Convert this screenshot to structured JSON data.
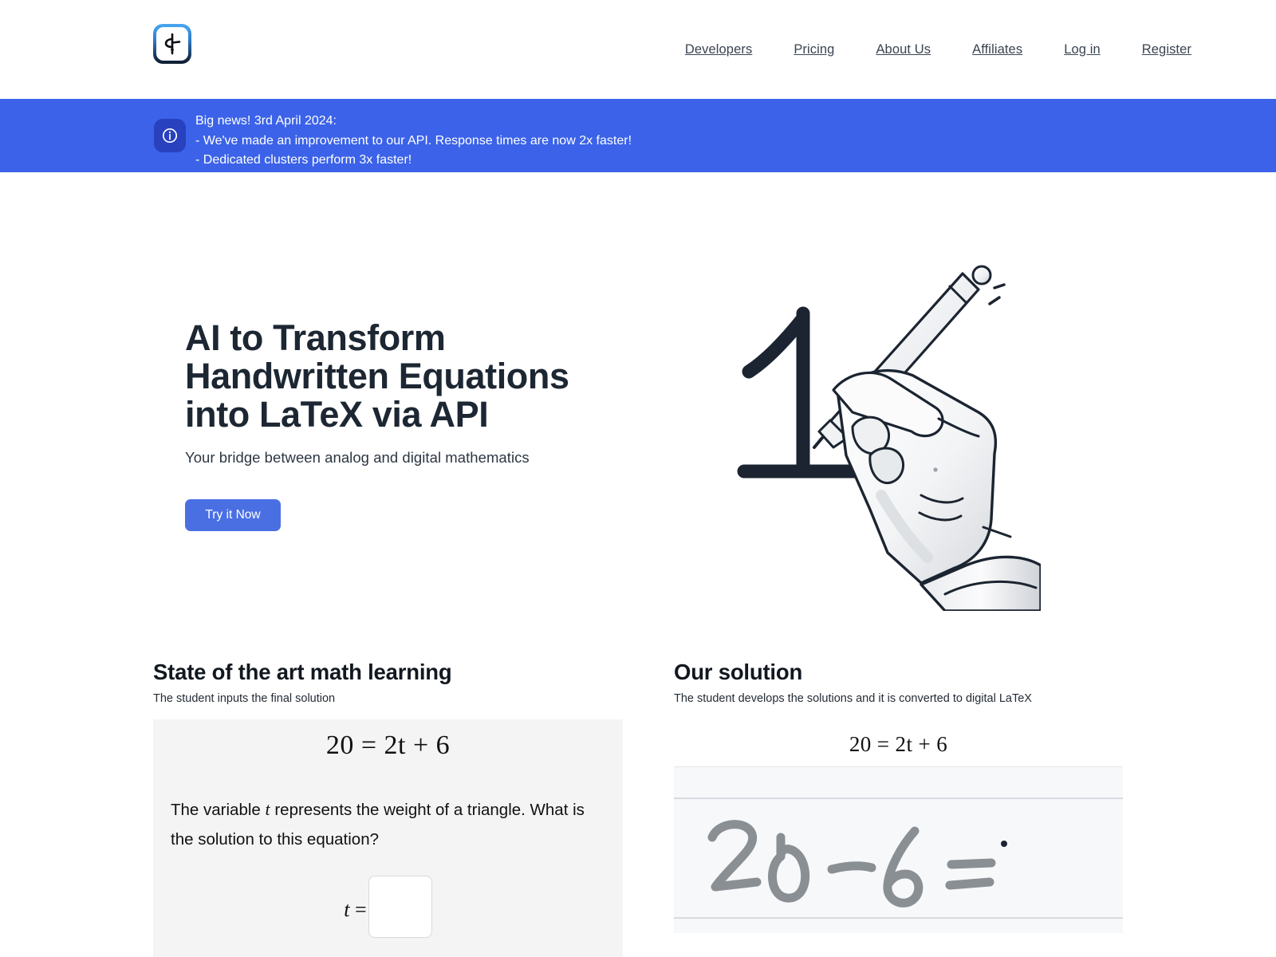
{
  "header": {
    "logo_icon": "pen-nib-logo-icon",
    "nav": [
      {
        "label": "Developers",
        "name": "developers"
      },
      {
        "label": "Pricing",
        "name": "pricing"
      },
      {
        "label": "About Us",
        "name": "about-us"
      },
      {
        "label": "Affiliates",
        "name": "affiliates"
      },
      {
        "label": "Log in",
        "name": "log-in"
      },
      {
        "label": "Register",
        "name": "register"
      }
    ]
  },
  "banner": {
    "icon": "info-circle-icon",
    "background_color": "#3b62e8",
    "icon_background_color": "#2741bf",
    "lines": [
      "Big news! 3rd April 2024:",
      "- We've made an improvement to our API. Response times are now 2x faster!",
      "- Dedicated clusters perform 3x faster!"
    ]
  },
  "hero": {
    "title": "AI to Transform Handwritten Equations into LaTeX via API",
    "subtitle": "Your bridge between analog and digital mathematics",
    "cta_label": "Try it Now",
    "cta_color": "#4a6fe3",
    "illustration": "hand-writing-digit-one-with-pen-illustration"
  },
  "sections": {
    "left": {
      "title": "State of the art math learning",
      "subtitle": "The student inputs the final solution",
      "equation": "20 = 2t + 6",
      "question": "The variable t represents the weight of a triangle. What is the solution to this equation?",
      "answer_label": "t =",
      "answer_value": "",
      "answer_placeholder": ""
    },
    "right": {
      "title": "Our solution",
      "subtitle": "The student develops the solutions and it is converted to digital LaTeX",
      "equation": "20 = 2t + 6",
      "handwriting": "20 - 6 =",
      "canvas_background": "#f7f8fa"
    }
  }
}
